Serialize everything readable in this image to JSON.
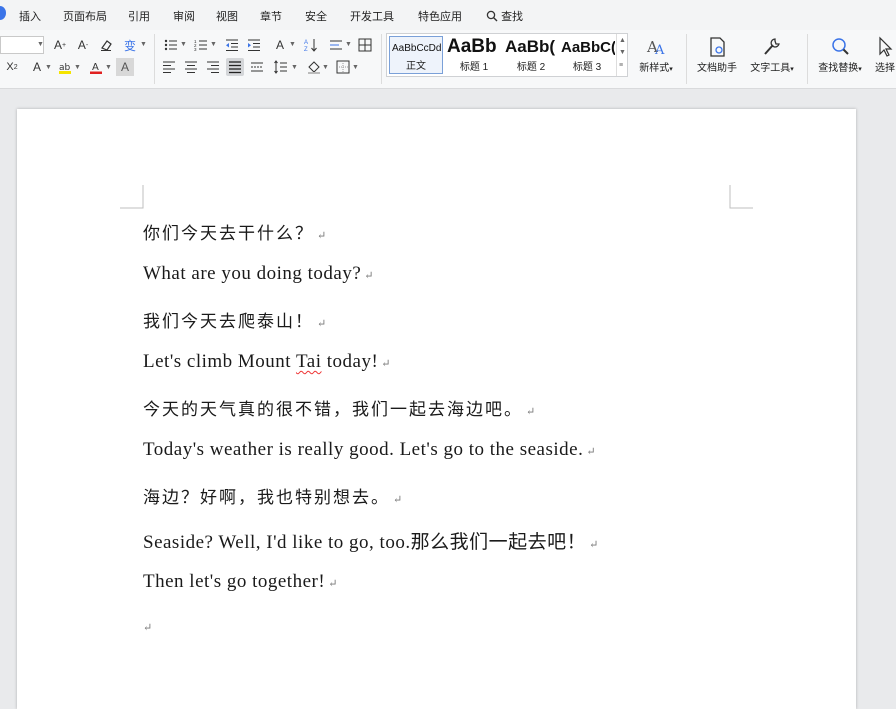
{
  "menu": {
    "items": [
      "插入",
      "页面布局",
      "引用",
      "审阅",
      "视图",
      "章节",
      "安全",
      "开发工具",
      "特色应用"
    ],
    "search_label": "查找"
  },
  "ribbon": {
    "styles": [
      {
        "preview": "AaBbCcDd",
        "name": "正文"
      },
      {
        "preview": "AaBb",
        "name": "标题 1"
      },
      {
        "preview": "AaBb(",
        "name": "标题 2"
      },
      {
        "preview": "AaBbC(",
        "name": "标题 3"
      }
    ],
    "new_style_label": "新样式",
    "doc_assistant_label": "文档助手",
    "text_tools_label": "文字工具",
    "find_replace_label": "查找替换",
    "select_label": "选择"
  },
  "document": {
    "paragraphs": [
      {
        "text": "你们今天去干什么？",
        "lang": "cn"
      },
      {
        "text": "What are you doing today?",
        "lang": "en"
      },
      {
        "text": "我们今天去爬泰山！",
        "lang": "cn"
      },
      {
        "pre": "Let's climb Mount ",
        "flag": "Tai",
        "post": " today!",
        "lang": "en"
      },
      {
        "text": "今天的天气真的很不错，我们一起去海边吧。",
        "lang": "cn"
      },
      {
        "text": "Today's weather is really good. Let's go to the seaside.",
        "lang": "en"
      },
      {
        "text": "海边？好啊，我也特别想去。",
        "lang": "cn"
      },
      {
        "text": "Seaside? Well, I'd like to go, too.那么我们一起去吧！",
        "lang": "en"
      },
      {
        "text": "Then let's go together!",
        "lang": "en"
      },
      {
        "text": "",
        "lang": "empty"
      }
    ],
    "paragraph_mark": "↵"
  },
  "colors": {
    "accent_blue": "#3b74e8",
    "font_color_red": "#e02020",
    "highlight_yellow": "#f5e400"
  }
}
